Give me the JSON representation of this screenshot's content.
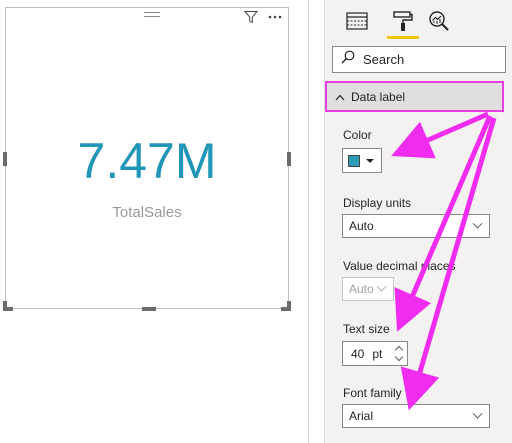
{
  "card": {
    "value": "7.47M",
    "label": "TotalSales",
    "filter_icon": "filter-icon",
    "more_icon": "more-options-icon"
  },
  "pane": {
    "tabs": [
      {
        "name": "fields",
        "icon": "fields-icon"
      },
      {
        "name": "format",
        "icon": "paint-roller-icon",
        "active": true
      },
      {
        "name": "analytics",
        "icon": "analytics-icon"
      }
    ],
    "search": {
      "placeholder": "Search"
    },
    "section": {
      "title": "Data label",
      "expanded": true
    },
    "color": {
      "label": "Color",
      "value": "#2d9db5"
    },
    "display_units": {
      "label": "Display units",
      "value": "Auto"
    },
    "decimal_places": {
      "label": "Value decimal places",
      "value": "Auto"
    },
    "text_size": {
      "label": "Text size",
      "value": "40",
      "unit": "pt"
    },
    "font_family": {
      "label": "Font family",
      "value": "Arial"
    }
  },
  "colors": {
    "accent_value": "#2196b6",
    "highlight": "#e63fe6",
    "tab_underline": "#f2c811"
  }
}
